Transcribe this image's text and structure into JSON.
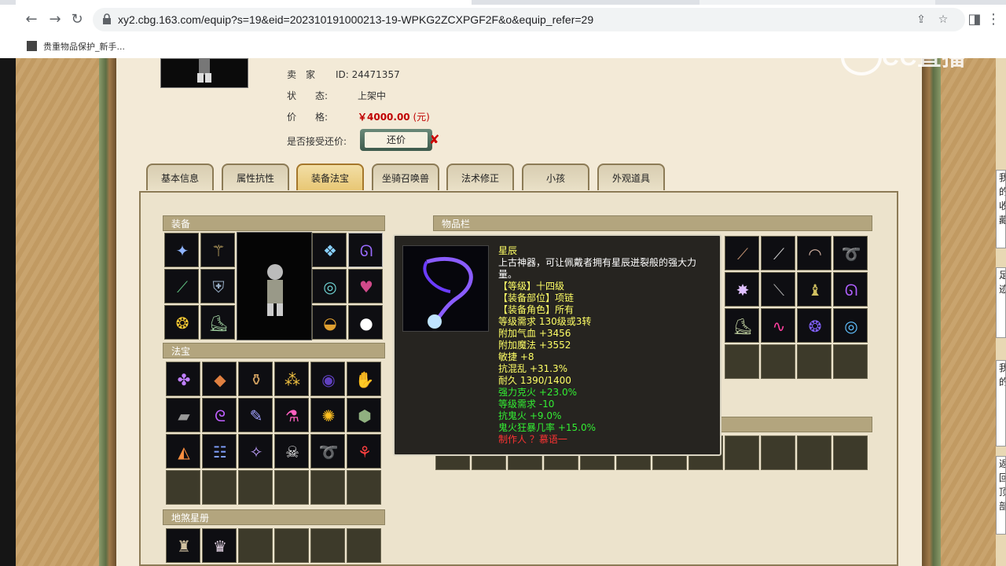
{
  "browser": {
    "url": "xy2.cbg.163.com/equip?s=19&eid=202310191000213-19-WPKG2ZCXPGF2F&o&equip_refer=29",
    "bookmark_label": "贵重物品保护_新手...",
    "watermark": "CC直播"
  },
  "listing": {
    "seller_label": "卖　家",
    "seller_value": "ID:  24471357",
    "status_label": "状　　态:",
    "status_value": "上架中",
    "price_label": "价　　格:",
    "price_value": "￥4000.00",
    "price_unit": "(元)",
    "counter_label": "是否接受还价:",
    "counter_button": "还价",
    "counter_mark": "✘"
  },
  "tabs": [
    "基本信息",
    "属性抗性",
    "装备法宝",
    "坐骑召唤兽",
    "法术修正",
    "小孩",
    "外观道具"
  ],
  "sections": {
    "equipment": "装备",
    "treasure": "法宝",
    "star_book": "地煞星册",
    "inventory": "物品栏"
  },
  "tooltip": {
    "name": "星辰",
    "desc_1": "上古神器，可让佩戴者拥有星辰迸裂般的强大力",
    "desc_2": "量。",
    "level": "【等级】十四级",
    "slot": "【装备部位】项链",
    "role": "【装备角色】所有",
    "req": "等级需求 130级或3转",
    "hp": "附加气血 +3456",
    "mp": "附加魔法 +3552",
    "agi": "敏捷 +8",
    "chaos": "抗混乱 +31.3%",
    "durability": "耐久 1390/1400",
    "fire": "强力克火 +23.0%",
    "req_reduce": "等级需求 -10",
    "ghost_fire": "抗鬼火 +9.0%",
    "ghost_crit": "鬼火狂暴几率 +15.0%",
    "maker": "制作人 ？慕语一"
  },
  "side_cards": [
    "我的收藏",
    "足迹",
    "我的",
    "返回顶部"
  ]
}
